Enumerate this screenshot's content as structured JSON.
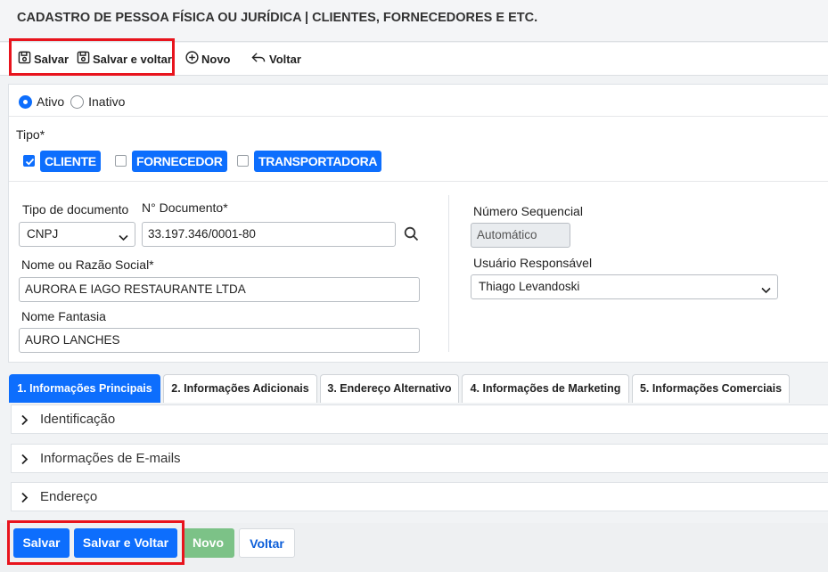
{
  "page": {
    "title": "CADASTRO DE PESSOA FÍSICA OU JURÍDICA | CLIENTES, FORNECEDORES E ETC."
  },
  "toolbar": {
    "save_label": "Salvar",
    "save_back_label": "Salvar e voltar",
    "new_label": "Novo",
    "back_label": "Voltar"
  },
  "status": {
    "active_label": "Ativo",
    "inactive_label": "Inativo",
    "selected": "Ativo"
  },
  "tipo": {
    "label": "Tipo*",
    "options": [
      {
        "label": "CLIENTE",
        "checked": true
      },
      {
        "label": "FORNECEDOR",
        "checked": false
      },
      {
        "label": "TRANSPORTADORA",
        "checked": false
      }
    ]
  },
  "form": {
    "doc_type_label": "Tipo de documento",
    "doc_type_value": "CNPJ",
    "doc_number_label": "N° Documento*",
    "doc_number_value": "33.197.346/0001-80",
    "name_label": "Nome ou Razão Social*",
    "name_value": "AURORA E IAGO RESTAURANTE LTDA",
    "fantasy_label": "Nome Fantasia",
    "fantasy_value": "AURO LANCHES",
    "seq_label": "Número Sequencial",
    "seq_value": "Automático",
    "user_label": "Usuário Responsável",
    "user_value": "Thiago Levandoski"
  },
  "tabs": [
    {
      "label": "1. Informações Principais",
      "active": true
    },
    {
      "label": "2. Informações Adicionais",
      "active": false
    },
    {
      "label": "3. Endereço Alternativo",
      "active": false
    },
    {
      "label": "4. Informações de Marketing",
      "active": false
    },
    {
      "label": "5. Informações Comerciais",
      "active": false
    }
  ],
  "accordion": [
    {
      "label": "Identificação"
    },
    {
      "label": "Informações de E-mails"
    },
    {
      "label": "Endereço"
    }
  ],
  "footer": {
    "save_label": "Salvar",
    "save_back_label": "Salvar e Voltar",
    "new_label": "Novo",
    "back_label": "Voltar"
  },
  "colors": {
    "primary": "#0d6efd",
    "success": "#7cc287",
    "highlight": "#e8141d"
  }
}
